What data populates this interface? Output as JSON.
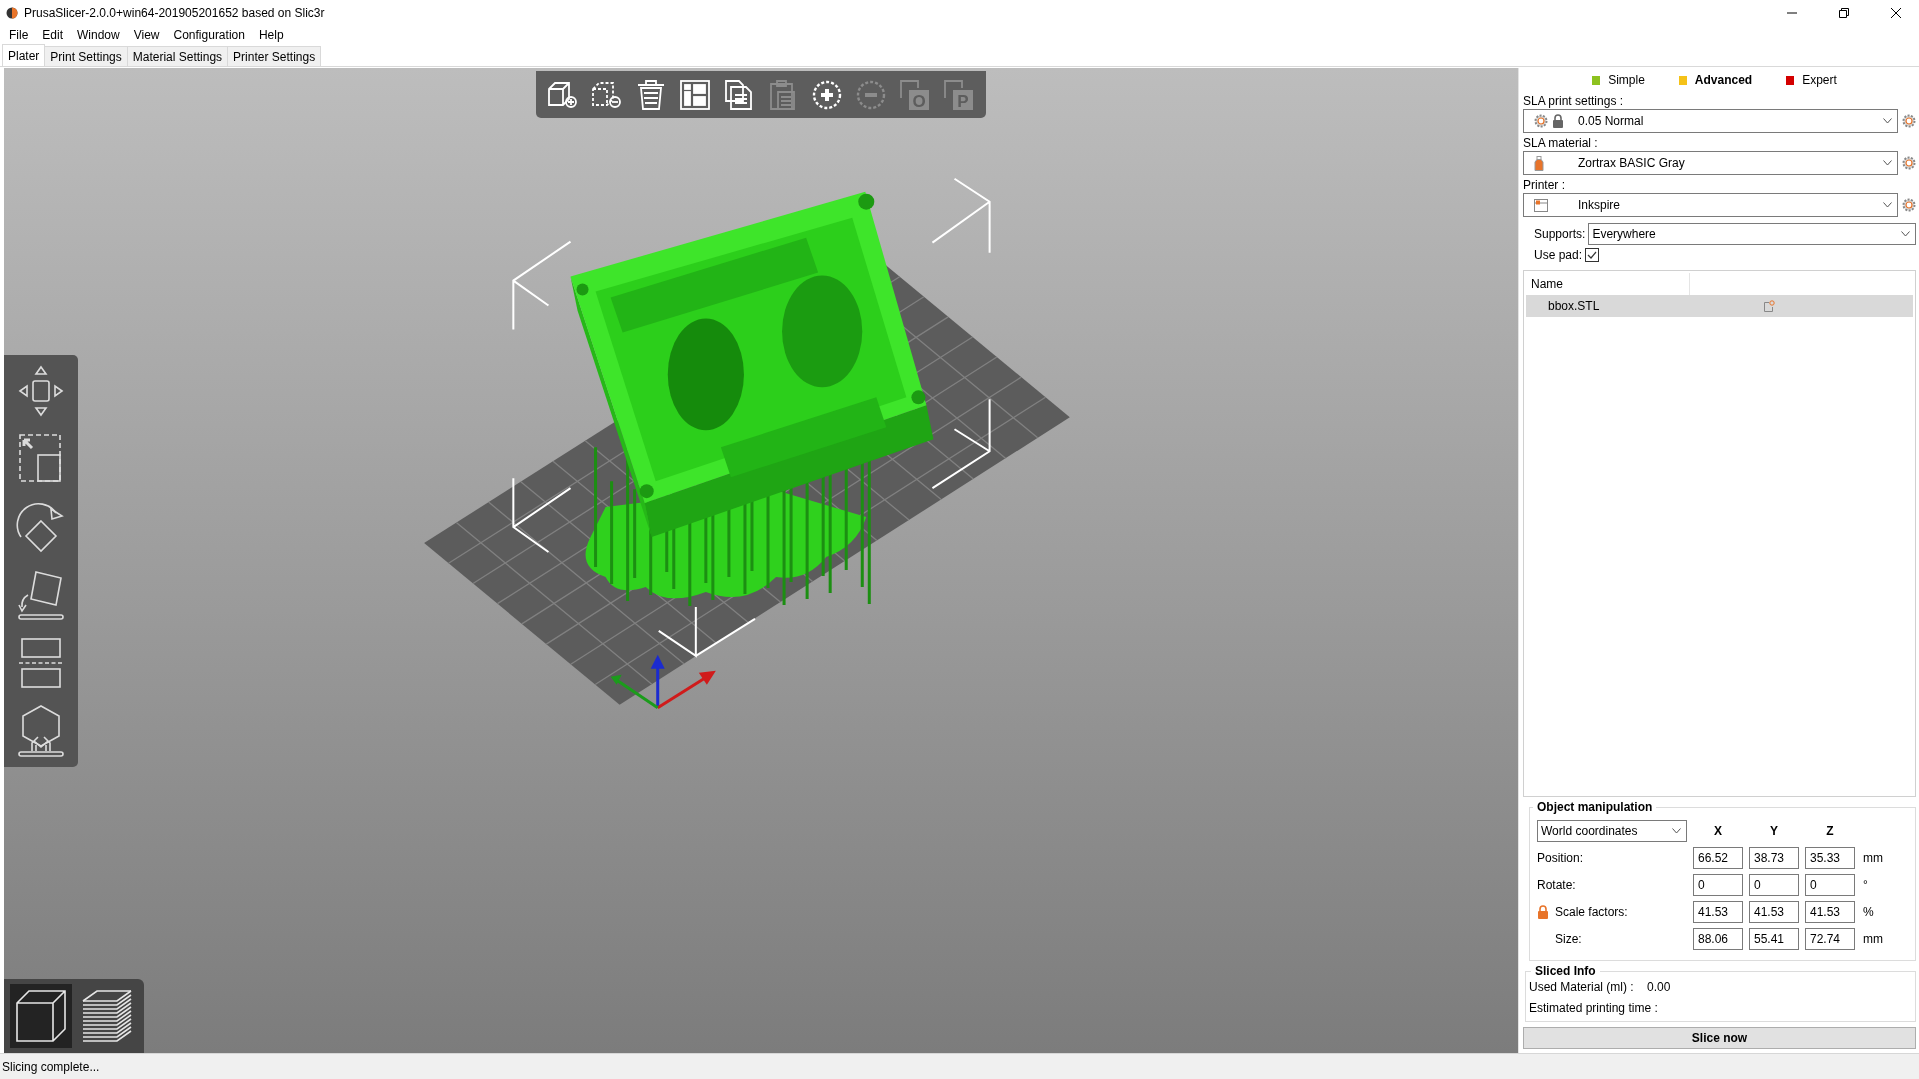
{
  "window": {
    "title": "PrusaSlicer-2.0.0+win64-201905201652 based on Slic3r"
  },
  "menu": [
    "File",
    "Edit",
    "Window",
    "View",
    "Configuration",
    "Help"
  ],
  "tabs": [
    {
      "label": "Plater",
      "selected": true
    },
    {
      "label": "Print Settings",
      "selected": false
    },
    {
      "label": "Material Settings",
      "selected": false
    },
    {
      "label": "Printer Settings",
      "selected": false
    }
  ],
  "toolbar": [
    {
      "kind": "add",
      "enabled": true
    },
    {
      "kind": "delete",
      "enabled": true
    },
    {
      "kind": "delete-all",
      "enabled": true
    },
    {
      "kind": "arrange",
      "enabled": true
    },
    {
      "kind": "copy",
      "enabled": true
    },
    {
      "kind": "paste",
      "enabled": false
    },
    {
      "kind": "add-instance",
      "enabled": true
    },
    {
      "kind": "remove-instance",
      "enabled": false
    },
    {
      "kind": "split",
      "enabled": false,
      "glyph": "O"
    },
    {
      "kind": "split",
      "enabled": false,
      "glyph": "P"
    }
  ],
  "gizmos": [
    {
      "kind": "move"
    },
    {
      "kind": "scale"
    },
    {
      "kind": "rotate"
    },
    {
      "kind": "place"
    },
    {
      "kind": "cut"
    },
    {
      "kind": "supports"
    }
  ],
  "view_toggle": [
    {
      "kind": "model",
      "selected": true
    },
    {
      "kind": "preview",
      "selected": false
    }
  ],
  "modes": [
    {
      "label": "Simple",
      "color": "#8dc21f",
      "selected": false
    },
    {
      "label": "Advanced",
      "color": "#f5c218",
      "selected": true
    },
    {
      "label": "Expert",
      "color": "#d40000",
      "selected": false
    }
  ],
  "presets": [
    {
      "kind": "print",
      "label": "SLA print settings :",
      "value": "0.05 Normal"
    },
    {
      "kind": "material",
      "label": "SLA material :",
      "value": "Zortrax BASIC Gray"
    },
    {
      "kind": "printer",
      "label": "Printer :",
      "value": "Inkspire"
    }
  ],
  "supports": {
    "label": "Supports:",
    "value": "Everywhere"
  },
  "use_pad": {
    "label": "Use pad:",
    "checked": true
  },
  "object_list": {
    "columns": [
      "Name"
    ],
    "rows": [
      {
        "name": "bbox.STL",
        "selected": true
      }
    ]
  },
  "object_manipulation": {
    "title": "Object manipulation",
    "coordinates": "World coordinates",
    "axes": [
      "X",
      "Y",
      "Z"
    ],
    "rows": [
      {
        "label": "Position:",
        "values": [
          "66.52",
          "38.73",
          "35.33"
        ],
        "unit": "mm",
        "locked": false
      },
      {
        "label": "Rotate:",
        "values": [
          "0",
          "0",
          "0"
        ],
        "unit": "°",
        "locked": false
      },
      {
        "label": "Scale factors:",
        "values": [
          "41.53",
          "41.53",
          "41.53"
        ],
        "unit": "%",
        "locked": true
      },
      {
        "label": "Size:",
        "values": [
          "88.06",
          "55.41",
          "72.74"
        ],
        "unit": "mm",
        "locked": false
      }
    ]
  },
  "sliced_info": {
    "title": "Sliced Info",
    "rows": [
      {
        "label": "Used Material (ml) :",
        "value": "0.00"
      },
      {
        "label": "Estimated printing time :"
      }
    ]
  },
  "slice_button": "Slice now",
  "status_bar": "Slicing complete..."
}
